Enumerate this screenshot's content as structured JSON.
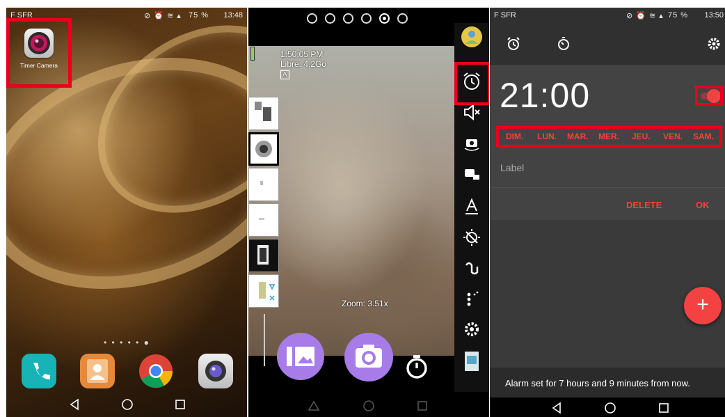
{
  "panel_home": {
    "status": {
      "carrier": "F SFR",
      "battery": "75 %",
      "time": "13:48"
    },
    "app_shortcut": {
      "label": "Timer Camera",
      "icon": "camera-lens-icon"
    },
    "page_indicator": "• • • • • ●",
    "dock_apps": [
      {
        "name": "phone",
        "icon": "phone-icon",
        "color": "#17b3b6"
      },
      {
        "name": "contacts",
        "icon": "contacts-icon",
        "color": "#e6893a"
      },
      {
        "name": "chrome",
        "icon": "chrome-icon",
        "color": "#db4437"
      },
      {
        "name": "camera",
        "icon": "camera-icon",
        "color": "#4a4a4a"
      }
    ],
    "nav": [
      "back-icon",
      "home-icon",
      "recents-icon"
    ]
  },
  "panel_camera": {
    "time": "1:50:05 PM",
    "storage": "Libre: 4,2Go",
    "badge": "A",
    "zoom": "Zoom: 3.51x",
    "pager": {
      "count": 6,
      "active": 4
    },
    "rail_icons": [
      "profile-icon",
      "alarm-clock-icon",
      "sound-off-icon",
      "switch-camera-icon",
      "camera-mode-icon",
      "text-icon",
      "exposure-icon",
      "flash-icon",
      "more-icon",
      "settings-icon",
      "gallery-thumb-icon"
    ],
    "bottom_buttons": [
      "gallery-icon",
      "shutter-icon",
      "timer-icon"
    ],
    "accent": "#a77be8"
  },
  "panel_alarm": {
    "status": {
      "carrier": "F SFR",
      "battery": "75 %",
      "time": "13:50"
    },
    "top_icons": [
      "alarm-icon",
      "timer-icon",
      "settings-icon"
    ],
    "time": "21:00",
    "enabled": true,
    "days": [
      "DIM.",
      "LUN.",
      "MAR.",
      "MER.",
      "JEU.",
      "VEN.",
      "SAM."
    ],
    "label_placeholder": "Label",
    "delete_label": "DELETE",
    "ok_label": "OK",
    "fab_label": "+",
    "snackbar": "Alarm set for 7 hours and 9 minutes from now.",
    "accent": "#f44242"
  }
}
